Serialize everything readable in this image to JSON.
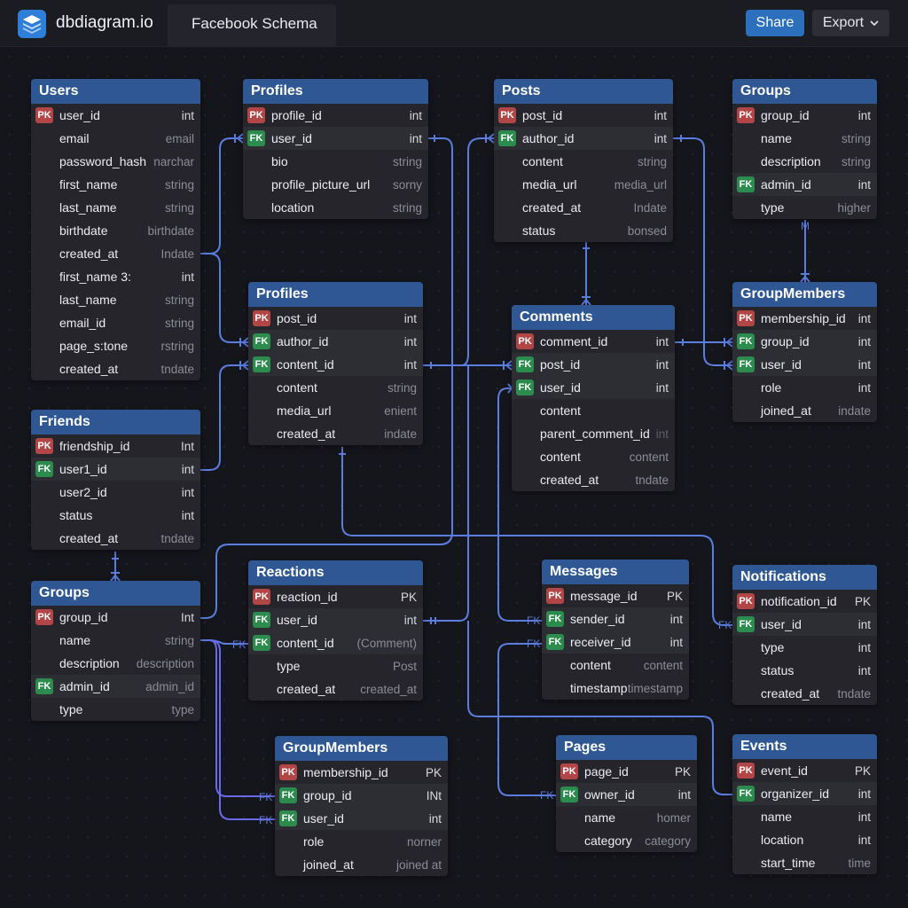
{
  "app": {
    "title": "dbdiagram.io",
    "tab": "Facebook Schema"
  },
  "toolbar": {
    "share": "Share",
    "export": "Export"
  },
  "colors": {
    "accent": "#2f5794",
    "pk": "#b24545",
    "fk": "#2c8c4e",
    "link": "#5b7de0"
  },
  "tables": [
    {
      "name": "Users",
      "cols": [
        {
          "key": "PK",
          "name": "user_id",
          "type": "int"
        },
        {
          "key": "",
          "name": "email",
          "type": "email"
        },
        {
          "key": "",
          "name": "password_hash",
          "type": "narchar"
        },
        {
          "key": "",
          "name": "first_name",
          "type": "string"
        },
        {
          "key": "",
          "name": "last_name",
          "type": "string"
        },
        {
          "key": "",
          "name": "birthdate",
          "type": "birthdate"
        },
        {
          "key": "",
          "name": "created_at",
          "type": "Indate"
        },
        {
          "key": "",
          "name": "first_name 3:",
          "type": "int"
        },
        {
          "key": "",
          "name": "last_name",
          "type": "string"
        },
        {
          "key": "",
          "name": "email_id",
          "type": "string"
        },
        {
          "key": "",
          "name": "page_s:tone",
          "type": "rstring"
        },
        {
          "key": "",
          "name": "created_at",
          "type": "tndate"
        }
      ]
    },
    {
      "name": "Profiles",
      "cols": [
        {
          "key": "PK",
          "name": "profile_id",
          "type": "int"
        },
        {
          "key": "FK",
          "name": "user_id",
          "type": "int"
        },
        {
          "key": "",
          "name": "bio",
          "type": "string"
        },
        {
          "key": "",
          "name": "profile_picture_url",
          "type": "sorny"
        },
        {
          "key": "",
          "name": "location",
          "type": "string"
        }
      ]
    },
    {
      "name": "Posts",
      "cols": [
        {
          "key": "PK",
          "name": "post_id",
          "type": "int"
        },
        {
          "key": "FK",
          "name": "author_id",
          "type": "int"
        },
        {
          "key": "",
          "name": "content",
          "type": "string"
        },
        {
          "key": "",
          "name": "media_url",
          "type": "media_url"
        },
        {
          "key": "",
          "name": "created_at",
          "type": "Indate"
        },
        {
          "key": "",
          "name": "status",
          "type": "bonsed"
        }
      ]
    },
    {
      "name": "Groups",
      "cols": [
        {
          "key": "PK",
          "name": "group_id",
          "type": "int"
        },
        {
          "key": "",
          "name": "name",
          "type": "string"
        },
        {
          "key": "",
          "name": "description",
          "type": "string"
        },
        {
          "key": "FK",
          "name": "admin_id",
          "type": "int"
        },
        {
          "key": "",
          "name": "type",
          "type": "higher"
        }
      ]
    },
    {
      "name": "Profiles",
      "cols": [
        {
          "key": "PK",
          "name": "post_id",
          "type": "int"
        },
        {
          "key": "FK",
          "name": "author_id",
          "type": "int"
        },
        {
          "key": "FK",
          "name": "content_id",
          "type": "int"
        },
        {
          "key": "",
          "name": "content",
          "type": "string"
        },
        {
          "key": "",
          "name": "media_url",
          "type": "enient"
        },
        {
          "key": "",
          "name": "created_at",
          "type": "indate"
        }
      ]
    },
    {
      "name": "Comments",
      "cols": [
        {
          "key": "PK",
          "name": "comment_id",
          "type": "int"
        },
        {
          "key": "FK",
          "name": "post_id",
          "type": "int"
        },
        {
          "key": "FK",
          "name": "user_id",
          "type": "int"
        },
        {
          "key": "",
          "name": "content",
          "type": ""
        },
        {
          "key": "",
          "name": "parent_comment_id",
          "type": "int"
        },
        {
          "key": "",
          "name": "content",
          "type": "content"
        },
        {
          "key": "",
          "name": "created_at",
          "type": "tndate"
        }
      ]
    },
    {
      "name": "GroupMembers",
      "cols": [
        {
          "key": "PK",
          "name": "membership_id",
          "type": "int"
        },
        {
          "key": "FK",
          "name": "group_id",
          "type": "int"
        },
        {
          "key": "FK",
          "name": "user_id",
          "type": "int"
        },
        {
          "key": "",
          "name": "role",
          "type": "int"
        },
        {
          "key": "",
          "name": "joined_at",
          "type": "indate"
        }
      ]
    },
    {
      "name": "Friends",
      "cols": [
        {
          "key": "PK",
          "name": "friendship_id",
          "type": "Int"
        },
        {
          "key": "FK",
          "name": "user1_id",
          "type": "int"
        },
        {
          "key": "",
          "name": "user2_id",
          "type": "int"
        },
        {
          "key": "",
          "name": "status",
          "type": "int"
        },
        {
          "key": "",
          "name": "created_at",
          "type": "tndate"
        }
      ]
    },
    {
      "name": "Groups",
      "cols": [
        {
          "key": "PK",
          "name": "group_id",
          "type": "Int"
        },
        {
          "key": "",
          "name": "name",
          "type": "string"
        },
        {
          "key": "",
          "name": "description",
          "type": "description"
        },
        {
          "key": "FK",
          "name": "admin_id",
          "type": "admin_id"
        },
        {
          "key": "",
          "name": "type",
          "type": "type"
        }
      ]
    },
    {
      "name": "Reactions",
      "cols": [
        {
          "key": "PK",
          "name": "reaction_id",
          "type": "PK"
        },
        {
          "key": "FK",
          "name": "user_id",
          "type": "int"
        },
        {
          "key": "FK",
          "name": "content_id",
          "type": "(Comment)"
        },
        {
          "key": "",
          "name": "type",
          "type": "Post"
        },
        {
          "key": "",
          "name": "created_at",
          "type": "created_at"
        }
      ]
    },
    {
      "name": "Messages",
      "cols": [
        {
          "key": "PK",
          "name": "message_id",
          "type": "PK"
        },
        {
          "key": "FK",
          "name": "sender_id",
          "type": "int"
        },
        {
          "key": "FK",
          "name": "receiver_id",
          "type": "int"
        },
        {
          "key": "",
          "name": "content",
          "type": "content"
        },
        {
          "key": "",
          "name": "timestamp",
          "type": "timestamp"
        }
      ]
    },
    {
      "name": "Notifications",
      "cols": [
        {
          "key": "PK",
          "name": "notification_id",
          "type": "PK"
        },
        {
          "key": "FK",
          "name": "user_id",
          "type": "int"
        },
        {
          "key": "",
          "name": "type",
          "type": "int"
        },
        {
          "key": "",
          "name": "status",
          "type": "int"
        },
        {
          "key": "",
          "name": "created_at",
          "type": "tndate"
        }
      ]
    },
    {
      "name": "GroupMembers",
      "cols": [
        {
          "key": "PK",
          "name": "membership_id",
          "type": "PK"
        },
        {
          "key": "FK",
          "name": "group_id",
          "type": "INt"
        },
        {
          "key": "FK",
          "name": "user_id",
          "type": "int"
        },
        {
          "key": "",
          "name": "role",
          "type": "norner"
        },
        {
          "key": "",
          "name": "joined_at",
          "type": "joined at"
        }
      ]
    },
    {
      "name": "Pages",
      "cols": [
        {
          "key": "PK",
          "name": "page_id",
          "type": "PK"
        },
        {
          "key": "FK",
          "name": "owner_id",
          "type": "int"
        },
        {
          "key": "",
          "name": "name",
          "type": "homer"
        },
        {
          "key": "",
          "name": "category",
          "type": "category"
        }
      ]
    },
    {
      "name": "Events",
      "cols": [
        {
          "key": "PK",
          "name": "event_id",
          "type": "PK"
        },
        {
          "key": "FK",
          "name": "organizer_id",
          "type": "int"
        },
        {
          "key": "",
          "name": "name",
          "type": "int"
        },
        {
          "key": "",
          "name": "location",
          "type": "int"
        },
        {
          "key": "",
          "name": "start_time",
          "type": "time"
        }
      ]
    }
  ],
  "link_labels": {
    "fk": "FK",
    "many": "M"
  }
}
